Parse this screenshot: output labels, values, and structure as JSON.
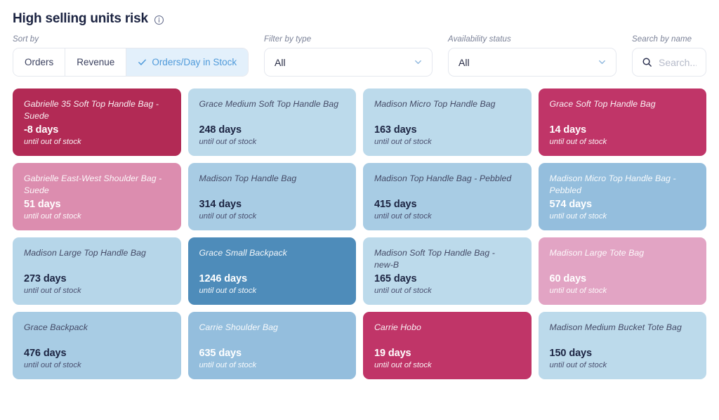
{
  "header": {
    "title": "High selling units risk",
    "info_icon": "info-circle-icon"
  },
  "filters": {
    "sort": {
      "label": "Sort by",
      "options": [
        "Orders",
        "Revenue",
        "Orders/Day in Stock"
      ],
      "selected": "Orders/Day in Stock",
      "check_icon": "check-icon"
    },
    "type": {
      "label": "Filter by type",
      "value": "All",
      "chevron_icon": "chevron-down-icon"
    },
    "availability": {
      "label": "Availability status",
      "value": "All",
      "chevron_icon": "chevron-down-icon"
    },
    "search": {
      "label": "Search by name",
      "value": "",
      "placeholder": "Search...",
      "icon": "search-icon"
    }
  },
  "card_sub_label": "until out of stock",
  "palette": {
    "crimson_deep": "#b22a55",
    "crimson": "#c03568",
    "pink_mid": "#dc8daf",
    "pink_light": "#e2a4c4",
    "blue_pale": "#bcdaeb",
    "blue_light": "#a8cce4",
    "blue_mid": "#94bedd",
    "blue_deep": "#4e8cba",
    "accent": "#4f9ada",
    "accent_bg": "#e3f0fb",
    "border": "#e5e8ef"
  },
  "cards": [
    {
      "name": "Gabrielle 35 Soft Top Handle Bag - Suede",
      "days": "-8 days",
      "bg": "#b22a55",
      "theme": "light"
    },
    {
      "name": "Grace Medium Soft Top Handle Bag",
      "days": "248 days",
      "bg": "#bcdaeb",
      "theme": "dark"
    },
    {
      "name": "Madison Micro Top Handle Bag",
      "days": "163 days",
      "bg": "#bcdaeb",
      "theme": "dark"
    },
    {
      "name": "Grace Soft Top Handle Bag",
      "days": "14 days",
      "bg": "#c03568",
      "theme": "light"
    },
    {
      "name": "Gabrielle East-West Shoulder Bag - Suede",
      "days": "51 days",
      "bg": "#dc8daf",
      "theme": "light"
    },
    {
      "name": "Madison Top Handle Bag",
      "days": "314 days",
      "bg": "#a8cce4",
      "theme": "dark"
    },
    {
      "name": "Madison Top Handle Bag - Pebbled",
      "days": "415 days",
      "bg": "#a8cce4",
      "theme": "dark"
    },
    {
      "name": "Madison Micro Top Handle Bag - Pebbled",
      "days": "574 days",
      "bg": "#94bedd",
      "theme": "light"
    },
    {
      "name": "Madison Large Top Handle Bag",
      "days": "273 days",
      "bg": "#b6d6e9",
      "theme": "dark"
    },
    {
      "name": "Grace Small Backpack",
      "days": "1246 days",
      "bg": "#4e8cba",
      "theme": "light"
    },
    {
      "name": "Madison Soft Top Handle Bag - new-B",
      "days": "165 days",
      "bg": "#bcdaeb",
      "theme": "dark"
    },
    {
      "name": "Madison Large Tote Bag",
      "days": "60 days",
      "bg": "#e2a4c4",
      "theme": "light"
    },
    {
      "name": "Grace Backpack",
      "days": "476 days",
      "bg": "#a8cce4",
      "theme": "dark"
    },
    {
      "name": "Carrie Shoulder Bag",
      "days": "635 days",
      "bg": "#94bedd",
      "theme": "light"
    },
    {
      "name": "Carrie Hobo",
      "days": "19 days",
      "bg": "#c03568",
      "theme": "light"
    },
    {
      "name": "Madison Medium Bucket Tote Bag",
      "days": "150 days",
      "bg": "#bcdaeb",
      "theme": "dark"
    }
  ]
}
